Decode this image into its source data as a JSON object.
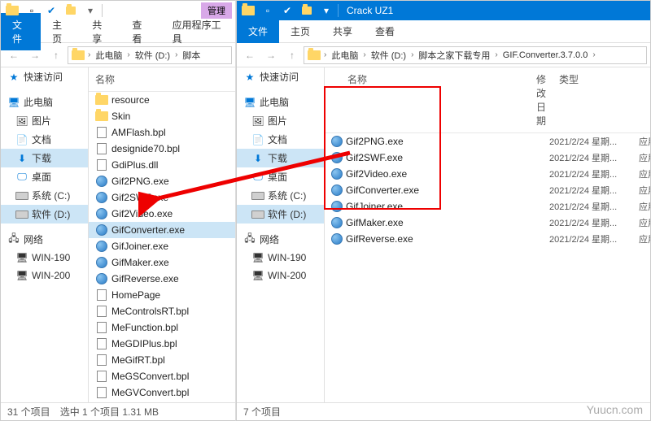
{
  "left": {
    "titlebar": {
      "manage": "管理"
    },
    "ribbon": {
      "file": "文件",
      "home": "主页",
      "share": "共享",
      "view": "查看",
      "apptools": "应用程序工具"
    },
    "addr": {
      "thispc": "此电脑",
      "drive": "软件 (D:)",
      "folder": "脚本"
    },
    "nav": {
      "quick": "快速访问",
      "thispc": "此电脑",
      "pictures": "图片",
      "documents": "文档",
      "downloads": "下载",
      "desktop": "桌面",
      "sysc": "系统 (C:)",
      "softd": "软件 (D:)",
      "network": "网络",
      "w190": "WIN-190",
      "w200": "WIN-200"
    },
    "cols": {
      "name": "名称"
    },
    "files": [
      {
        "n": "resource",
        "t": "folder"
      },
      {
        "n": "Skin",
        "t": "folder"
      },
      {
        "n": "AMFlash.bpl",
        "t": "file"
      },
      {
        "n": "designide70.bpl",
        "t": "file"
      },
      {
        "n": "GdiPlus.dll",
        "t": "file"
      },
      {
        "n": "Gif2PNG.exe",
        "t": "exe"
      },
      {
        "n": "Gif2SWF.exe",
        "t": "exe"
      },
      {
        "n": "Gif2Video.exe",
        "t": "exe"
      },
      {
        "n": "GifConverter.exe",
        "t": "exe",
        "sel": true
      },
      {
        "n": "GifJoiner.exe",
        "t": "exe"
      },
      {
        "n": "GifMaker.exe",
        "t": "exe"
      },
      {
        "n": "GifReverse.exe",
        "t": "exe"
      },
      {
        "n": "HomePage",
        "t": "file"
      },
      {
        "n": "MeControlsRT.bpl",
        "t": "file"
      },
      {
        "n": "MeFunction.bpl",
        "t": "file"
      },
      {
        "n": "MeGDIPlus.bpl",
        "t": "file"
      },
      {
        "n": "MeGifRT.bpl",
        "t": "file"
      },
      {
        "n": "MeGSConvert.bpl",
        "t": "file"
      },
      {
        "n": "MeGVConvert.bpl",
        "t": "file"
      }
    ],
    "status": {
      "count": "31 个项目",
      "sel": "选中 1 个项目  1.31 MB"
    }
  },
  "right": {
    "title": "Crack UZ1",
    "ribbon": {
      "file": "文件",
      "home": "主页",
      "share": "共享",
      "view": "查看"
    },
    "addr": {
      "thispc": "此电脑",
      "drive": "软件 (D:)",
      "dl": "脚本之家下载专用",
      "app": "GIF.Converter.3.7.0.0"
    },
    "nav": {
      "quick": "快速访问",
      "thispc": "此电脑",
      "pictures": "图片",
      "documents": "文档",
      "downloads": "下载",
      "desktop": "桌面",
      "sysc": "系统 (C:)",
      "softd": "软件 (D:)",
      "network": "网络",
      "w190": "WIN-190",
      "w200": "WIN-200"
    },
    "cols": {
      "name": "名称",
      "date": "修改日期",
      "type": "类型"
    },
    "files": [
      {
        "n": "Gif2PNG.exe",
        "d": "2021/2/24 星期...",
        "ty": "应用程序"
      },
      {
        "n": "Gif2SWF.exe",
        "d": "2021/2/24 星期...",
        "ty": "应用程序"
      },
      {
        "n": "Gif2Video.exe",
        "d": "2021/2/24 星期...",
        "ty": "应用程序"
      },
      {
        "n": "GifConverter.exe",
        "d": "2021/2/24 星期...",
        "ty": "应用程序"
      },
      {
        "n": "GifJoiner.exe",
        "d": "2021/2/24 星期...",
        "ty": "应用程序"
      },
      {
        "n": "GifMaker.exe",
        "d": "2021/2/24 星期...",
        "ty": "应用程序"
      },
      {
        "n": "GifReverse.exe",
        "d": "2021/2/24 星期...",
        "ty": "应用程序"
      }
    ],
    "status": {
      "count": "7 个项目"
    }
  },
  "watermark": "Yuucn.com"
}
